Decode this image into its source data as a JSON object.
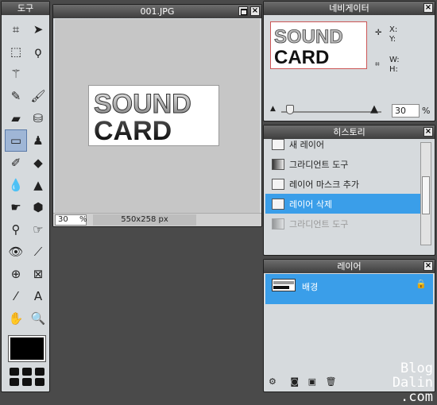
{
  "tools": {
    "title": "도구",
    "items": [
      {
        "name": "crop-icon",
        "glyph": "⌗"
      },
      {
        "name": "move-icon",
        "glyph": "➤"
      },
      {
        "name": "marquee-icon",
        "glyph": "⬚"
      },
      {
        "name": "lasso-icon",
        "glyph": "ϙ"
      },
      {
        "name": "magic-wand-icon",
        "glyph": "⚚"
      },
      {
        "name": "blank",
        "glyph": ""
      },
      {
        "name": "pencil-icon",
        "glyph": "✎"
      },
      {
        "name": "brush-icon",
        "glyph": "🖌"
      },
      {
        "name": "eraser-icon",
        "glyph": "▰"
      },
      {
        "name": "bucket-icon",
        "glyph": "⛁"
      },
      {
        "name": "gradient-icon",
        "glyph": "▭"
      },
      {
        "name": "stamp-icon",
        "glyph": "♟"
      },
      {
        "name": "color-replace-icon",
        "glyph": "✐"
      },
      {
        "name": "shape-icon",
        "glyph": "◆"
      },
      {
        "name": "drop-icon",
        "glyph": "💧"
      },
      {
        "name": "sharpen-icon",
        "glyph": "▲"
      },
      {
        "name": "smudge-icon",
        "glyph": "☛"
      },
      {
        "name": "sponge-icon",
        "glyph": "⬢"
      },
      {
        "name": "burn-icon",
        "glyph": "⚲"
      },
      {
        "name": "dodge-icon",
        "glyph": "☞"
      },
      {
        "name": "red-eye-icon",
        "glyph": "👁"
      },
      {
        "name": "bandage-icon",
        "glyph": "⟋"
      },
      {
        "name": "bloat-icon",
        "glyph": "⊕"
      },
      {
        "name": "pinch-icon",
        "glyph": "⊠"
      },
      {
        "name": "eyedropper-icon",
        "glyph": "⁄"
      },
      {
        "name": "type-icon",
        "glyph": "A"
      },
      {
        "name": "hand-icon",
        "glyph": "✋"
      },
      {
        "name": "zoom-icon",
        "glyph": "🔍"
      }
    ]
  },
  "canvas": {
    "title": "001.JPG",
    "image_text_top": "SOUND",
    "image_text_bottom": "CARD",
    "zoom_value": "30",
    "zoom_unit": "%",
    "size": "550x258 px"
  },
  "navigator": {
    "title": "네비게이터",
    "x_label": "X:",
    "y_label": "Y:",
    "w_label": "W:",
    "h_label": "H:",
    "zoom": "30",
    "zoom_unit": "%"
  },
  "history": {
    "title": "히스토리",
    "items": [
      {
        "label": "새 레이어"
      },
      {
        "label": "그라디언트 도구"
      },
      {
        "label": "레이어 마스크 추가"
      },
      {
        "label": "레이어 삭제"
      },
      {
        "label": "그라디언트 도구"
      }
    ]
  },
  "layers": {
    "title": "레이어",
    "layer_name": "배경"
  },
  "watermark": {
    "line1": "Blog Dalin",
    "line2": ".com"
  }
}
